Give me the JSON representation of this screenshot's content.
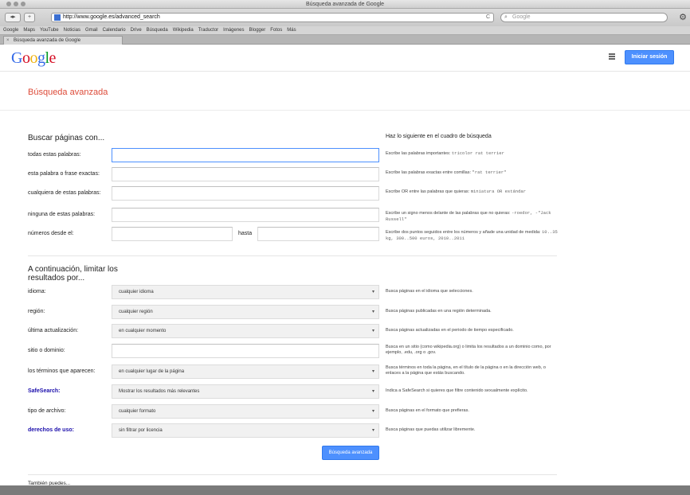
{
  "window": {
    "title": "Búsqueda avanzada de Google"
  },
  "toolbar": {
    "back": "◂",
    "forward": "▸",
    "add_tab": "+",
    "url": "http://www.google.es/advanced_search",
    "reload": "C",
    "search_placeholder": "Google"
  },
  "bookmarks": [
    "Google",
    "Maps",
    "YouTube",
    "Noticias",
    "Gmail",
    "Calendario",
    "Drive",
    "Búsqueda",
    "Wikipedia",
    "Traductor",
    "Imágenes",
    "Blogger",
    "Fotos",
    "Más"
  ],
  "tab": {
    "label": "Búsqueda avanzada de Google"
  },
  "header": {
    "logo": "Google",
    "signin_label": "Iniciar sesión"
  },
  "page": {
    "title": "Búsqueda avanzada",
    "find_heading": "Buscar páginas con...",
    "right_heading": "Haz lo siguiente en el cuadro de búsqueda",
    "narrow_heading": "A continuación, limitar los resultados por...",
    "submit_label": "Búsqueda avanzada",
    "footer_label": "También puedes..."
  },
  "find_rows": [
    {
      "label": "todas estas palabras:",
      "value": "",
      "hint": "Escribe las palabras importantes:",
      "example": "tricolor rat terrier"
    },
    {
      "label": "esta palabra o frase exactas:",
      "value": "",
      "hint": "Escribe las palabras exactas entre comillas:",
      "example": "\"rat terrier\""
    },
    {
      "label": "cualquiera de estas palabras:",
      "value": "",
      "hint": "Escribe OR entre las palabras que quieras:",
      "example": "miniatura OR estándar"
    },
    {
      "label": "ninguna de estas palabras:",
      "value": "",
      "hint": "Escribe un signo menos delante de las palabras que no quieras:",
      "example": "-roedor, -\"Jack Russell\""
    },
    {
      "label": "números desde el:",
      "value": "",
      "hint": "Escribe dos puntos seguidos entre los números y añade una unidad de medida:",
      "example": "10..35 kg, 300..500 euros, 2010..2011"
    }
  ],
  "range_to_label": "hasta",
  "range_to_value": "",
  "narrow_rows": [
    {
      "label": "idioma:",
      "value": "cualquier idioma",
      "hint": "Busca páginas en el idioma que selecciones."
    },
    {
      "label": "región:",
      "value": "cualquier región",
      "hint": "Busca páginas publicadas en una región determinada."
    },
    {
      "label": "última actualización:",
      "value": "en cualquier momento",
      "hint": "Busca páginas actualizadas en el periodo de tiempo especificado."
    },
    {
      "label": "sitio o dominio:",
      "value": "",
      "hint": "Busca en un sitio (como wikipedia.org) o limita los resultados a un dominio como, por ejemplo, .edu, .org o .gov."
    },
    {
      "label": "los términos que aparecen:",
      "value": "en cualquier lugar de la página",
      "hint": "Busca términos en toda la página, en el título de la página o en la dirección web, o enlaces a la página que estás buscando."
    },
    {
      "label": "SafeSearch:",
      "value": "Mostrar los resultados más relevantes",
      "hint": "Indica a SafeSearch si quieres que filtre contenido sexualmente explícito.",
      "link": true
    },
    {
      "label": "tipo de archivo:",
      "value": "cualquier formato",
      "hint": "Busca páginas en el formato que prefieras."
    },
    {
      "label": "derechos de uso:",
      "value": "sin filtrar por licencia",
      "hint": "Busca páginas que puedas utilizar libremente.",
      "link": true
    }
  ]
}
